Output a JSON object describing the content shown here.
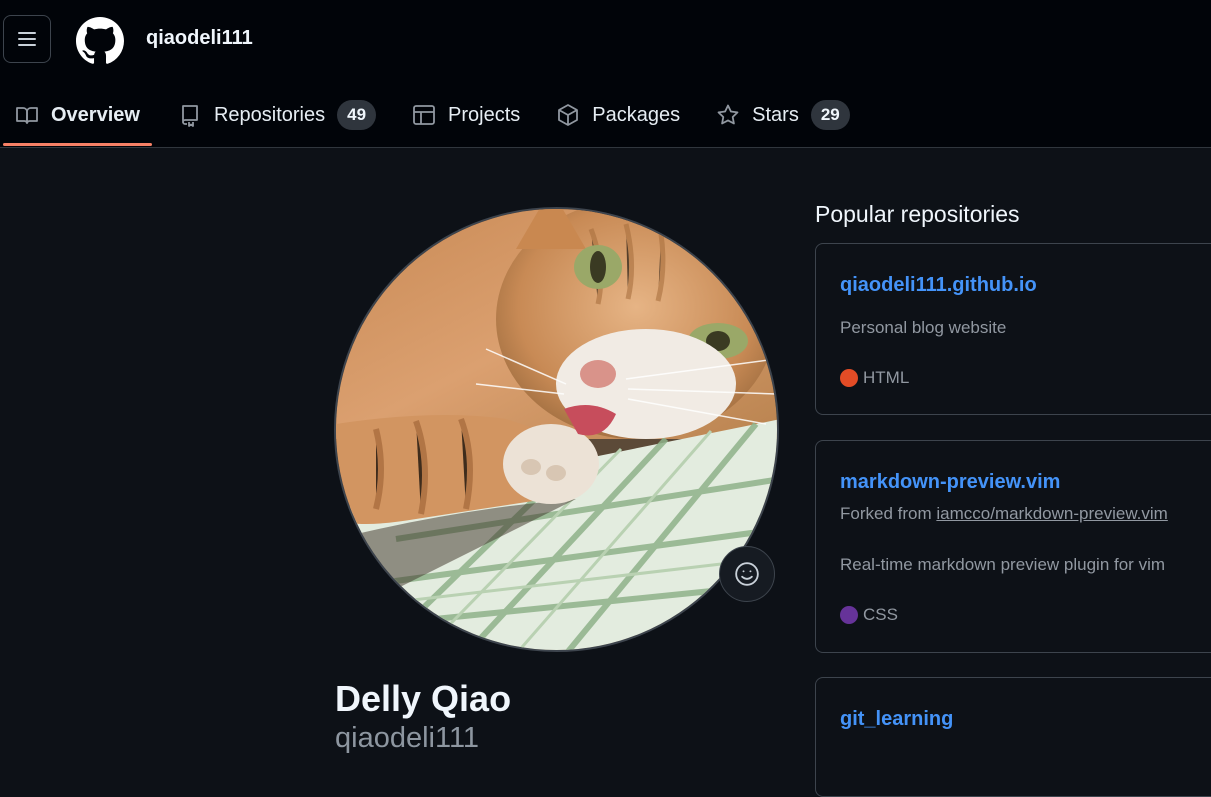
{
  "header": {
    "username": "qiaodeli111"
  },
  "tabs": [
    {
      "label": "Overview",
      "icon": "book-icon",
      "active": true
    },
    {
      "label": "Repositories",
      "icon": "repo-icon",
      "count": "49"
    },
    {
      "label": "Projects",
      "icon": "table-icon"
    },
    {
      "label": "Packages",
      "icon": "package-icon"
    },
    {
      "label": "Stars",
      "icon": "star-icon",
      "count": "29"
    }
  ],
  "profile": {
    "full_name": "Delly Qiao",
    "login": "qiaodeli111",
    "avatar_icon": "cat-photo-avatar",
    "status_icon": "smiley-icon"
  },
  "popular": {
    "title": "Popular repositories",
    "repos": [
      {
        "name": "qiaodeli111.github.io",
        "description": "Personal blog website",
        "language": "HTML",
        "language_color": "#e34c26"
      },
      {
        "name": "markdown-preview.vim",
        "fork_prefix": "Forked from",
        "fork_source": "iamcco/markdown-preview.vim",
        "description": "Real-time markdown preview plugin for vim",
        "language": "CSS",
        "language_color": "#663399"
      },
      {
        "name": "git_learning"
      }
    ]
  },
  "colors": {
    "accent_underline": "#f78166",
    "link": "#4493f8",
    "background": "#0d1117",
    "header_background": "#010409"
  }
}
